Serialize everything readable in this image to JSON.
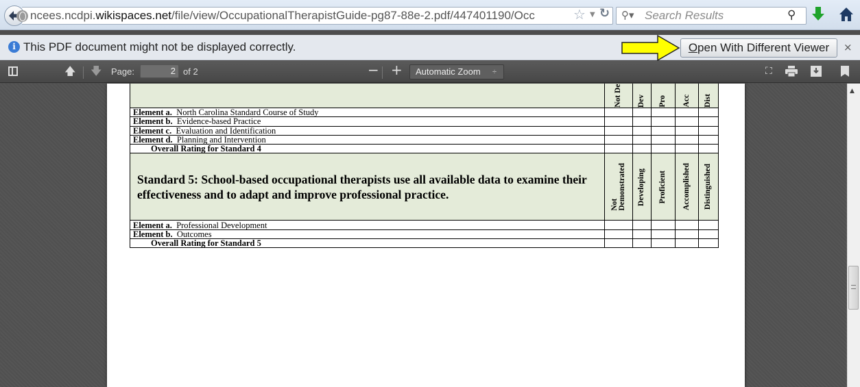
{
  "browser": {
    "url_prefix": "ncees.ncdpi.",
    "url_domain": "wikispaces.net",
    "url_path": "/file/view/OccupationalTherapistGuide-pg87-88e-2.pdf/447401190/Occ",
    "search_placeholder": "Search Results"
  },
  "notification": {
    "message": "This PDF document might not be displayed correctly.",
    "button_accesskey": "O",
    "button_rest": "pen With Different Viewer",
    "close": "×"
  },
  "pdf_toolbar": {
    "page_label": "Page:",
    "page_value": "2",
    "page_of": "of 2",
    "zoom_value": "Automatic Zoom",
    "zoom_out": "−",
    "zoom_in": "+"
  },
  "document": {
    "top_headers_cut": [
      "Not Dem",
      "Dev",
      "Pro",
      "Acc",
      "Dist"
    ],
    "standard4_rows": [
      {
        "element": "Element a.",
        "text": "North Carolina Standard Course of Study"
      },
      {
        "element": "Element b.",
        "text": "Evidence-based Practice"
      },
      {
        "element": "Element c.",
        "text": "Evaluation and Identification"
      },
      {
        "element": "Element d.",
        "text": "Planning and Intervention"
      }
    ],
    "standard4_overall": "Overall Rating for Standard 4",
    "standard5_title": "Standard 5: School-based occupational therapists use all available data to examine their effectiveness and to adapt and improve professional practice.",
    "rating_headers": [
      {
        "line1": "Not",
        "line2": "Demonstrated"
      },
      {
        "line1": "Developing"
      },
      {
        "line1": "Proficient"
      },
      {
        "line1": "Accomplished"
      },
      {
        "line1": "Distinguished"
      }
    ],
    "standard5_rows": [
      {
        "element": "Element a.",
        "text": "Professional Development"
      },
      {
        "element": "Element b.",
        "text": "Outcomes"
      }
    ],
    "standard5_overall": "Overall Rating for Standard 5"
  },
  "colors": {
    "header_fill": "#e4ebd9",
    "arrow_fill": "#ffff00",
    "toolbar_bg": "#4e4e4e",
    "viewer_bg": "#525252"
  }
}
